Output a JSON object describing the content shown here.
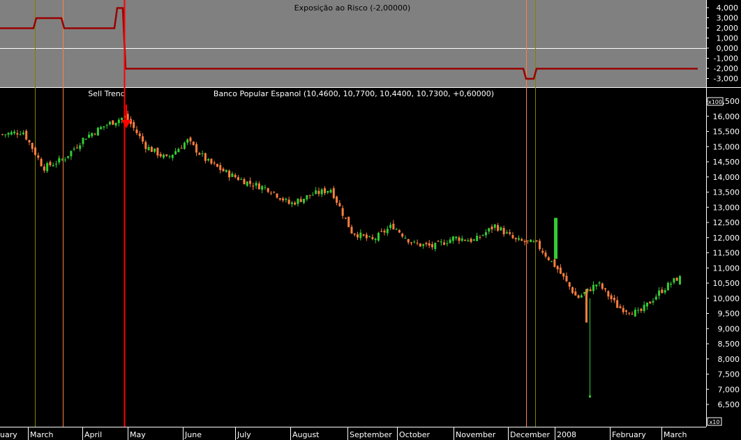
{
  "colors": {
    "top_panel_bg": "#808080",
    "main_bg": "#000000",
    "up_candle": "#33cc33",
    "down_candle": "#ff7f3f",
    "risk_line": "#990000",
    "sell_marker": "#ff0000",
    "axis_text": "#ffffff",
    "vline_olive": "#808000",
    "vline_orange": "#ff8040"
  },
  "top_panel": {
    "title": "Exposição ao Risco (-2,00000)",
    "multiplier": "x100",
    "y_ticks": [
      "4,000",
      "3,000",
      "2,000",
      "1,000",
      "0,000",
      "-1,000",
      "-2,000",
      "-3,000"
    ]
  },
  "main_panel": {
    "title": "Banco Popular Espanol (10,4600, 10,7700, 10,4400, 10,7300, +0,60000)",
    "sell_label": "Sell Trend",
    "multiplier": "x10",
    "y_ticks": [
      "16,500",
      "16,000",
      "15,500",
      "15,000",
      "14,500",
      "14,000",
      "13,500",
      "13,000",
      "12,500",
      "12,000",
      "11,500",
      "11,000",
      "10,500",
      "10,000",
      "9,500",
      "9,000",
      "8,500",
      "8,000",
      "7,500",
      "7,000",
      "6,500"
    ]
  },
  "x_axis": {
    "labels": [
      "uary",
      "March",
      "April",
      "May",
      "June",
      "July",
      "August",
      "September",
      "October",
      "November",
      "December",
      "2008",
      "February",
      "March"
    ]
  },
  "chart_data": {
    "type": "candlestick",
    "title": "Banco Popular Espanol (10,4600, 10,7700, 10,4400, 10,7300, +0,60000)",
    "last_bar": {
      "open": 10.46,
      "high": 10.77,
      "low": 10.44,
      "close": 10.73,
      "change": 0.6
    },
    "x_labels": [
      "uary",
      "March",
      "April",
      "May",
      "June",
      "July",
      "August",
      "September",
      "October",
      "November",
      "December",
      "2008",
      "February",
      "March"
    ],
    "y_range": [
      6.3,
      16.8
    ],
    "annotations": [
      "Sell Trend"
    ],
    "close_path": [
      {
        "period": "late January",
        "close": 15.4
      },
      {
        "period": "February",
        "close": 15.5
      },
      {
        "period": "early March",
        "close": 14.3
      },
      {
        "period": "mid March",
        "close": 14.6
      },
      {
        "period": "late March",
        "close": 15.3
      },
      {
        "period": "April",
        "close": 15.7
      },
      {
        "period": "mid April",
        "close": 16.0
      },
      {
        "period": "late April (Sell Trend)",
        "close": 15.0
      },
      {
        "period": "May",
        "close": 14.6
      },
      {
        "period": "late May",
        "close": 15.2
      },
      {
        "period": "June",
        "close": 14.5
      },
      {
        "period": "late June",
        "close": 14.1
      },
      {
        "period": "July",
        "close": 13.8
      },
      {
        "period": "mid July",
        "close": 13.6
      },
      {
        "period": "late July",
        "close": 13.1
      },
      {
        "period": "August",
        "close": 13.4
      },
      {
        "period": "late August",
        "close": 13.6
      },
      {
        "period": "early September",
        "close": 12.2
      },
      {
        "period": "September",
        "close": 11.9
      },
      {
        "period": "October",
        "close": 12.4
      },
      {
        "period": "late October",
        "close": 11.8
      },
      {
        "period": "November",
        "close": 11.7
      },
      {
        "period": "mid November",
        "close": 12.0
      },
      {
        "period": "late November",
        "close": 11.9
      },
      {
        "period": "December",
        "close": 12.4
      },
      {
        "period": "mid December",
        "close": 11.9
      },
      {
        "period": "late December",
        "close": 11.8
      },
      {
        "period": "early January 2008",
        "close": 11.0
      },
      {
        "period": "mid January 2008",
        "close": 10.0
      },
      {
        "period": "late January 2008",
        "close": 10.5
      },
      {
        "period": "February",
        "close": 9.7
      },
      {
        "period": "mid February",
        "close": 9.5
      },
      {
        "period": "late February",
        "close": 10.2
      },
      {
        "period": "March",
        "close": 10.73
      }
    ],
    "spikes": [
      {
        "period": "late January 2008",
        "low": 6.75
      }
    ],
    "risk_exposure_series": [
      {
        "period": "January",
        "value": 2.0
      },
      {
        "period": "early March",
        "value": 3.0
      },
      {
        "period": "mid March",
        "value": 2.0
      },
      {
        "period": "late April",
        "value": 4.0
      },
      {
        "period": "May onward",
        "value": -2.0
      },
      {
        "period": "early December",
        "value": -3.0
      },
      {
        "period": "mid December onward",
        "value": -2.0
      }
    ]
  }
}
